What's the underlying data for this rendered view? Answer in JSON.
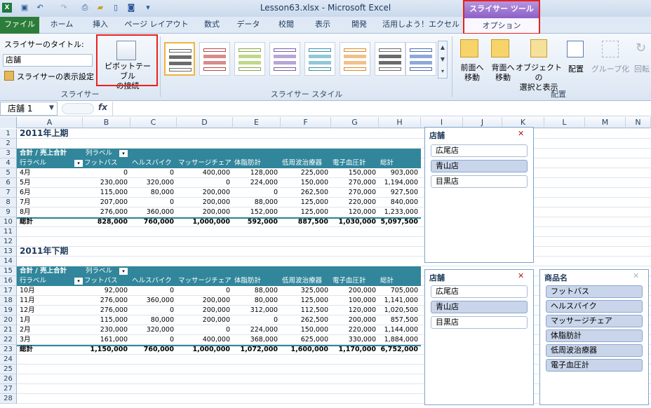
{
  "window": {
    "title": "Lesson63.xlsx - Microsoft Excel"
  },
  "tabs": [
    "ファイル",
    "ホーム",
    "挿入",
    "ページ レイアウト",
    "数式",
    "データ",
    "校閲",
    "表示",
    "開発",
    "活用しよう！エクセル"
  ],
  "context": {
    "group": "スライサー ツール",
    "tab": "オプション"
  },
  "ribbon": {
    "caption_label": "スライサーのタイトル:",
    "caption_value": "店舗",
    "settings_label": "スライサーの表示設定",
    "group_slicer": "スライサー",
    "pivot_line1": "ピボットテーブル",
    "pivot_line2": "の接続",
    "group_style": "スライサー スタイル",
    "bring_forward_1": "前面へ",
    "bring_forward_2": "移動",
    "send_back_1": "背面へ",
    "send_back_2": "移動",
    "selection_1": "オブジェクトの",
    "selection_2": "選択と表示",
    "align": "配置",
    "group_btn": "グループ化",
    "rotate": "回転",
    "group_arrange": "配置"
  },
  "formula": {
    "namebox": "店舗 1",
    "fx": "fx",
    "value": ""
  },
  "columns": [
    "A",
    "B",
    "C",
    "D",
    "E",
    "F",
    "G",
    "H",
    "I",
    "J",
    "K",
    "L",
    "M",
    "N"
  ],
  "rows": [
    "1",
    "2",
    "3",
    "4",
    "5",
    "6",
    "7",
    "8",
    "9",
    "10",
    "11",
    "12",
    "13",
    "14",
    "15",
    "16",
    "17",
    "18",
    "19",
    "20",
    "21",
    "22",
    "23",
    "24",
    "25",
    "26",
    "27",
    "28"
  ],
  "pivot1": {
    "title": "2011年上期",
    "header": "合計 / 売上合計",
    "collabel": "列ラベル",
    "rowlabel": "行ラベル",
    "cols": [
      "フットバス",
      "ヘルスバイク",
      "マッサージチェア",
      "体脂肪計",
      "低周波治療器",
      "電子血圧計",
      "総計"
    ],
    "rows": [
      [
        "4月",
        "0",
        "0",
        "400,000",
        "128,000",
        "225,000",
        "150,000",
        "903,000"
      ],
      [
        "5月",
        "230,000",
        "320,000",
        "0",
        "224,000",
        "150,000",
        "270,000",
        "1,194,000"
      ],
      [
        "6月",
        "115,000",
        "80,000",
        "200,000",
        "0",
        "262,500",
        "270,000",
        "927,500"
      ],
      [
        "7月",
        "207,000",
        "0",
        "200,000",
        "88,000",
        "125,000",
        "220,000",
        "840,000"
      ],
      [
        "8月",
        "276,000",
        "360,000",
        "200,000",
        "152,000",
        "125,000",
        "120,000",
        "1,233,000"
      ]
    ],
    "total": [
      "総計",
      "828,000",
      "760,000",
      "1,000,000",
      "592,000",
      "887,500",
      "1,030,000",
      "5,097,500"
    ]
  },
  "pivot2": {
    "title": "2011年下期",
    "header": "合計 / 売上合計",
    "collabel": "列ラベル",
    "rowlabel": "行ラベル",
    "cols": [
      "フットバス",
      "ヘルスバイク",
      "マッサージチェア",
      "体脂肪計",
      "低周波治療器",
      "電子血圧計",
      "総計"
    ],
    "rows": [
      [
        "10月",
        "92,000",
        "0",
        "0",
        "88,000",
        "325,000",
        "200,000",
        "705,000"
      ],
      [
        "11月",
        "276,000",
        "360,000",
        "200,000",
        "80,000",
        "125,000",
        "100,000",
        "1,141,000"
      ],
      [
        "12月",
        "276,000",
        "0",
        "200,000",
        "312,000",
        "112,500",
        "120,000",
        "1,020,500"
      ],
      [
        "1月",
        "115,000",
        "80,000",
        "200,000",
        "0",
        "262,500",
        "200,000",
        "857,500"
      ],
      [
        "2月",
        "230,000",
        "320,000",
        "0",
        "224,000",
        "150,000",
        "220,000",
        "1,144,000"
      ],
      [
        "3月",
        "161,000",
        "0",
        "400,000",
        "368,000",
        "625,000",
        "330,000",
        "1,884,000"
      ]
    ],
    "total": [
      "総計",
      "1,150,000",
      "760,000",
      "1,000,000",
      "1,072,000",
      "1,600,000",
      "1,170,000",
      "6,752,000"
    ]
  },
  "slicer1": {
    "title": "店舗",
    "items": [
      {
        "label": "広尾店",
        "selected": false
      },
      {
        "label": "青山店",
        "selected": true
      },
      {
        "label": "目黒店",
        "selected": false
      }
    ]
  },
  "slicer2": {
    "title": "店舗",
    "items": [
      {
        "label": "広尾店",
        "selected": false
      },
      {
        "label": "青山店",
        "selected": true
      },
      {
        "label": "目黒店",
        "selected": false
      }
    ]
  },
  "slicer3": {
    "title": "商品名",
    "items": [
      {
        "label": "フットバス"
      },
      {
        "label": "ヘルスバイク"
      },
      {
        "label": "マッサージチェア"
      },
      {
        "label": "体脂肪計"
      },
      {
        "label": "低周波治療器"
      },
      {
        "label": "電子血圧計"
      }
    ]
  },
  "colors": {
    "pivot_header": "#31869b",
    "file_tab": "#2d7d3a",
    "slicer_tools": "#8d5fc8",
    "highlight": "#e8211d",
    "selected_item": "#c9d5ea"
  }
}
